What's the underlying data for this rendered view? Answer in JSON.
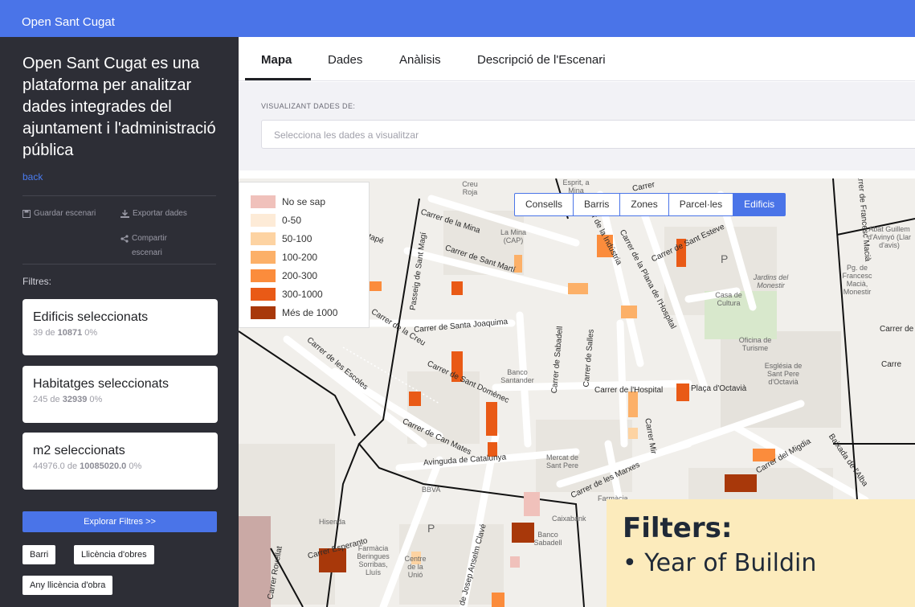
{
  "header": {
    "brand": "Open Sant Cugat"
  },
  "sidebar": {
    "title": "Open Sant Cugat es una plataforma per analitzar dades integrades del ajuntament i l'administració pública",
    "back": "back",
    "actions": {
      "save": "Guardar escenari",
      "export": "Exportar dades",
      "share": "Compartir escenari"
    },
    "filters_label": "Filtres:",
    "cards": [
      {
        "title": "Edificis seleccionats",
        "selected": "39",
        "of": "de",
        "total": "10871",
        "pct": "0%"
      },
      {
        "title": "Habitatges seleccionats",
        "selected": "245",
        "of": "de",
        "total": "32939",
        "pct": "0%"
      },
      {
        "title": "m2 seleccionats",
        "selected": "44976.0",
        "of": "de",
        "total": "10085020.0",
        "pct": "0%"
      }
    ],
    "explore_button": "Explorar Filtres >>",
    "chips": [
      "Barri",
      "Llicència d'obres",
      "Any llicència d'obra"
    ]
  },
  "tabs": {
    "items": [
      "Mapa",
      "Dades",
      "Anàlisis",
      "Descripció de l'Escenari"
    ],
    "active": "Mapa"
  },
  "visualizing": {
    "label": "VISUALIZANT DADES DE:",
    "placeholder": "Selecciona les dades a visualitzar"
  },
  "map": {
    "layer_switch": {
      "items": [
        "Consells",
        "Barris",
        "Zones",
        "Parcel·les",
        "Edificis"
      ],
      "active": "Edificis"
    },
    "legend": [
      {
        "label": "No se sap",
        "color": "#f0c1bb"
      },
      {
        "label": "0-50",
        "color": "#fdebd7"
      },
      {
        "label": "50-100",
        "color": "#fdd3a2"
      },
      {
        "label": "100-200",
        "color": "#fcb068"
      },
      {
        "label": "200-300",
        "color": "#fb8c3c"
      },
      {
        "label": "300-1000",
        "color": "#e95a16"
      },
      {
        "label": "Més de 1000",
        "color": "#a8380a"
      }
    ],
    "streets": [
      "Carrer de la Mina",
      "Carrer de Sant Martí",
      "Carrer de Sant Esteve",
      "Carrer de la Indústria",
      "Carrer de la Plana de l'Hospital",
      "Carrer de Santa Joaquima",
      "Passeig de Sant Magí",
      "Carrer de les Escoles",
      "Carrer de Sant Domènec",
      "Carrer de Can Mates",
      "Carrer de Sabadell",
      "Carrer de Salles",
      "Carrer de l'Hospital",
      "Plaça d'Octavià",
      "Avinguda de Catalunya",
      "Carrer de les Marxes",
      "Carrer del Migdia",
      "Baixada de l'Alba",
      "Carrer Mir",
      "Carrer de Francesc Macià",
      "Carrer Esperanto",
      "Carrer de Josep Anselm Clavé",
      "Carrer Rovellat",
      "Carrer de la Creu",
      "Carrer de Villa",
      "Estapé",
      "Carrer",
      "Carrer de",
      "Carre"
    ],
    "places": [
      "Creu Roja",
      "La Mina (CAP)",
      "Casa de Cultura",
      "Jardins del Monestir",
      "Oficina de Turisme",
      "Església de Sant Pere d'Octavià",
      "Banco Santander",
      "Mercat de Sant Pere",
      "BBVA",
      "Caixabank",
      "Banco Sabadell",
      "Hisenda",
      "Farmàcia Beringues Sorribas, Lluís",
      "Centre de la Unió",
      "Farmàcia",
      "Abat Guillem d'Avinyó (Llar d'avis)",
      "Pg. de Francesc Macià, Monestir",
      "Esprit, a Mina",
      "P"
    ]
  },
  "overlay": {
    "title": "Filters:",
    "bullet": "Year of Buildin"
  },
  "colors": {
    "topbar": "#4a74e8",
    "sidebar": "#2d2e36",
    "accent": "#4a74e8",
    "overlay": "#fcebbc"
  }
}
